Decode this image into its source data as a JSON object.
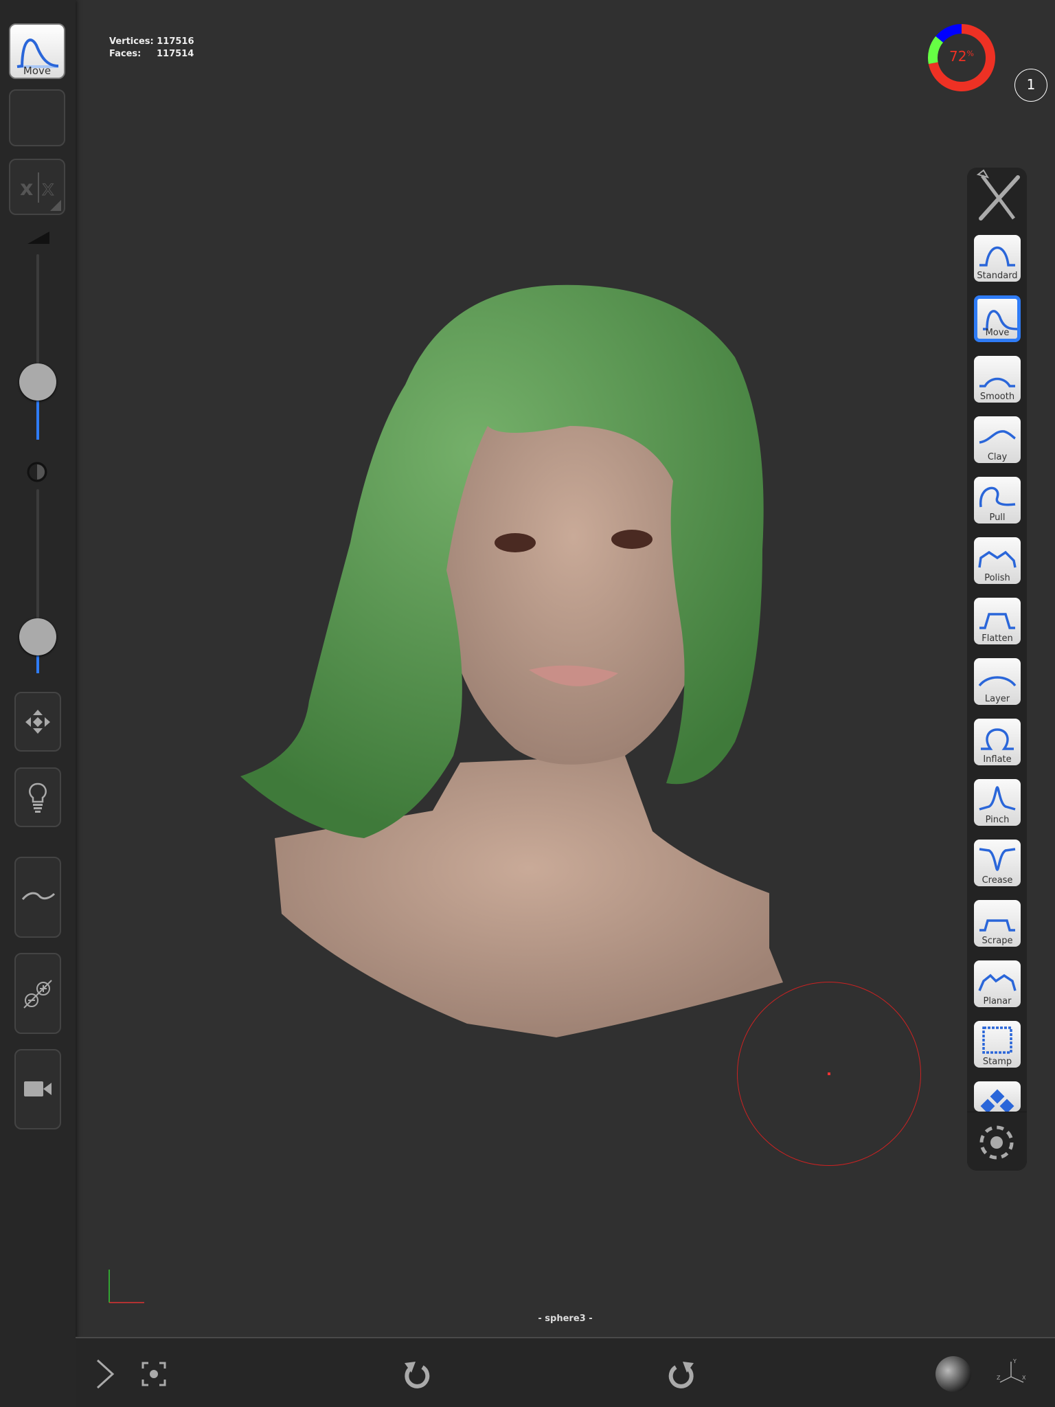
{
  "stats": {
    "vertices_label": "Vertices:",
    "vertices": "117516",
    "faces_label": "Faces:",
    "faces": "117514"
  },
  "sidebar": {
    "current_tool": {
      "label": "Move",
      "icon": "move-brush-icon"
    },
    "symmetry_icon": "symmetry-x-icon",
    "radius_slider": {
      "icon": "radius-triangle-icon",
      "value_percent": 35
    },
    "intensity_slider": {
      "icon": "contrast-icon",
      "value_percent": 15
    },
    "buttons": [
      {
        "name": "transform",
        "icon": "move-arrows-icon"
      },
      {
        "name": "lighting",
        "icon": "lightbulb-icon"
      },
      {
        "name": "stroke",
        "icon": "tilde-curve-icon"
      },
      {
        "name": "add-remove",
        "icon": "add-remove-icon"
      },
      {
        "name": "camera",
        "icon": "video-camera-icon"
      }
    ]
  },
  "memory_gauge": {
    "text": "72",
    "unit": "%",
    "segments": [
      {
        "color": "#ee3124",
        "percent": 72
      },
      {
        "color": "#66ff44",
        "percent": 14
      },
      {
        "color": "#0000ff",
        "percent": 14
      }
    ]
  },
  "layer_badge": "1",
  "tools_panel": {
    "header_icon": "brush-tools-icon",
    "selected": "Move",
    "tools": [
      "Standard",
      "Move",
      "Smooth",
      "Clay",
      "Pull",
      "Polish",
      "Flatten",
      "Layer",
      "Inflate",
      "Pinch",
      "Crease",
      "Scrape",
      "Planar",
      "Stamp",
      ""
    ],
    "settings_icon": "settings-dots-icon"
  },
  "object_name": "- sphere3 -",
  "bottom_bar": {
    "icons": [
      "chevron-right-icon",
      "focus-icon",
      "undo-icon",
      "redo-icon",
      "matcap-sphere-icon",
      "axes-icon"
    ],
    "axes_labels": [
      "Y",
      "Z",
      "X"
    ]
  },
  "colors": {
    "accent": "#2f7cf6",
    "brush_cursor": "#cc2222",
    "hair": "#5f9a55",
    "skin": "#b89a8a"
  }
}
